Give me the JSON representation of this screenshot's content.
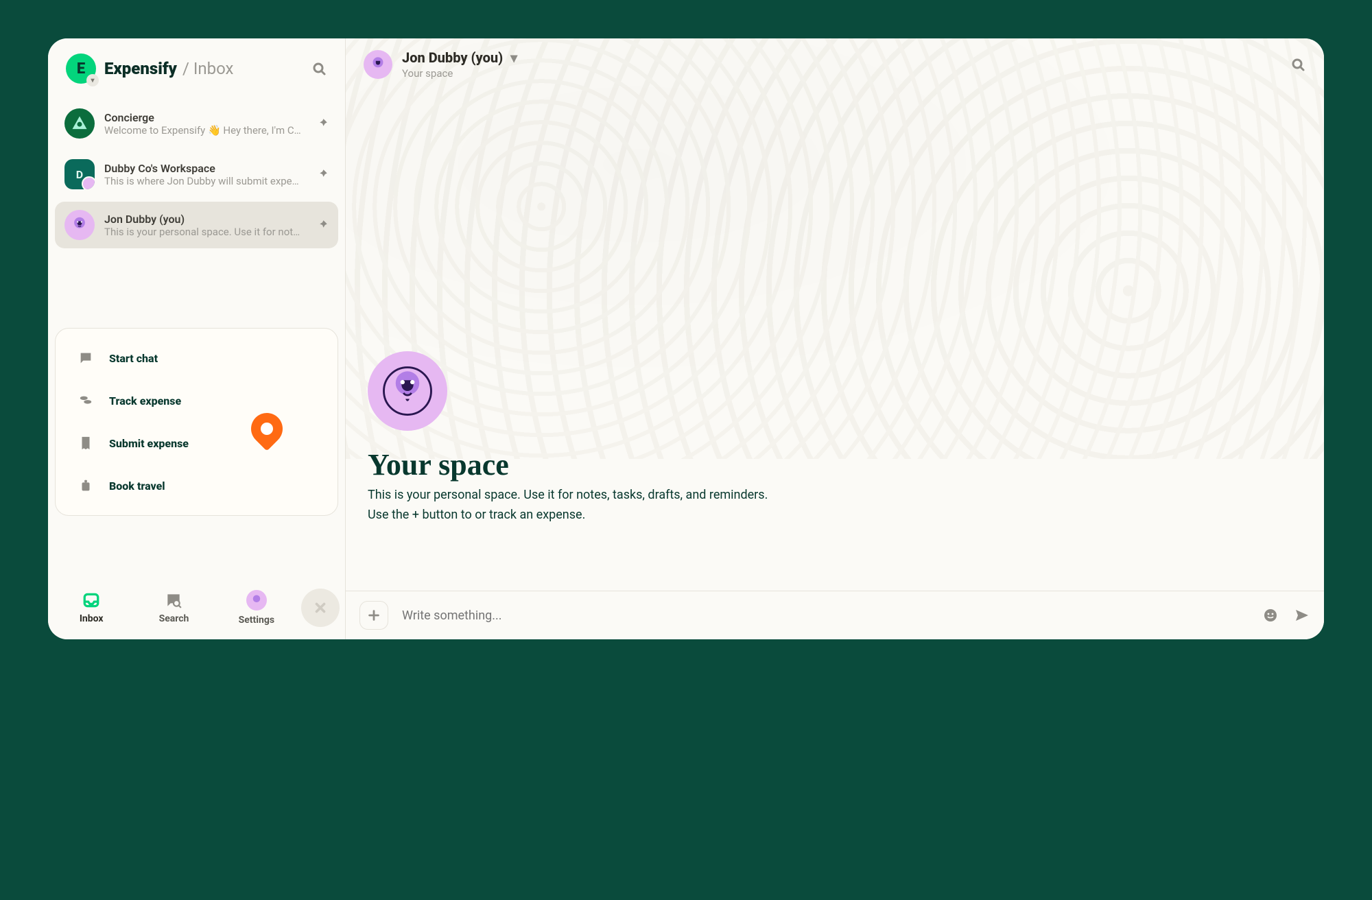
{
  "sidebar": {
    "brand": "Expensify",
    "crumb": "/ Inbox",
    "items": [
      {
        "name": "Concierge",
        "preview": "Welcome to Expensify 👋 Hey there, I'm Co…"
      },
      {
        "name": "Dubby Co's Workspace",
        "preview": "This is where Jon Dubby will submit expen…",
        "avatar_letter": "D"
      },
      {
        "name": "Jon Dubby (you)",
        "preview": "This is your personal space. Use it for note…"
      }
    ],
    "card": {
      "start_chat": "Start chat",
      "track_expense": "Track expense",
      "submit_expense": "Submit expense",
      "book_travel": "Book travel"
    }
  },
  "nav": {
    "inbox": "Inbox",
    "search": "Search",
    "settings": "Settings"
  },
  "header": {
    "title": "Jon Dubby (you)",
    "subtitle": "Your space"
  },
  "main": {
    "title": "Your space",
    "p1": "This is your personal space. Use it for notes, tasks, drafts, and reminders.",
    "p2": "Use the + button to or track an expense."
  },
  "compose": {
    "placeholder": "Write something..."
  }
}
